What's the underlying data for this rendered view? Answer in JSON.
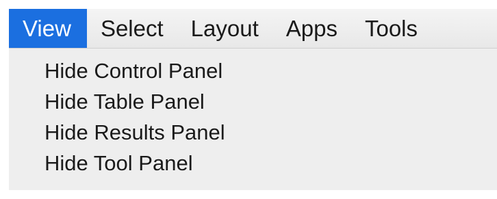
{
  "menubar": {
    "items": [
      {
        "label": "View",
        "active": true
      },
      {
        "label": "Select",
        "active": false
      },
      {
        "label": "Layout",
        "active": false
      },
      {
        "label": "Apps",
        "active": false
      },
      {
        "label": "Tools",
        "active": false
      }
    ]
  },
  "view_menu": {
    "items": [
      {
        "label": "Hide Control Panel"
      },
      {
        "label": "Hide Table Panel"
      },
      {
        "label": "Hide Results Panel"
      },
      {
        "label": "Hide Tool Panel"
      }
    ]
  },
  "colors": {
    "active_menu_bg": "#1b6fe0",
    "menubar_bg": "#ececec",
    "dropdown_bg": "#eeeeee",
    "text": "#1a1a1a"
  }
}
